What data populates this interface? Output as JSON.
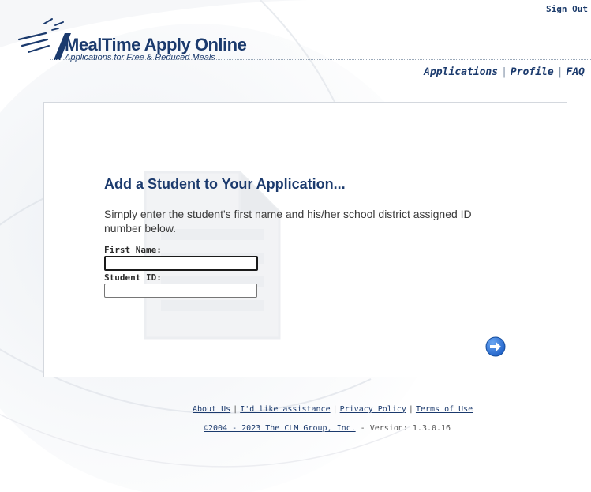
{
  "header": {
    "sign_out": "Sign Out",
    "logo_title": "MealTime Apply Online",
    "logo_subtitle": "Applications for Free & Reduced Meals",
    "nav": {
      "applications": "Applications",
      "profile": "Profile",
      "faq": "FAQ",
      "separator": "|"
    }
  },
  "panel": {
    "title": "Add a Student to Your Application...",
    "description": "Simply enter the student's first name and his/her school district assigned ID number below.",
    "fields": {
      "first_name_label": "First Name:",
      "first_name_value": "",
      "student_id_label": "Student ID:",
      "student_id_value": ""
    },
    "next_button_icon": "arrow-right-circle-icon"
  },
  "footer": {
    "links": {
      "about": "About Us",
      "assistance": "I'd like assistance",
      "privacy": "Privacy Policy",
      "terms": "Terms of Use",
      "separator": "|"
    },
    "copyright_link": "©2004 - 2023 The CLM Group, Inc.",
    "version": " - Version: 1.3.0.16"
  },
  "colors": {
    "brand_navy": "#1b3a6d",
    "button_blue": "#2a6fd6"
  }
}
